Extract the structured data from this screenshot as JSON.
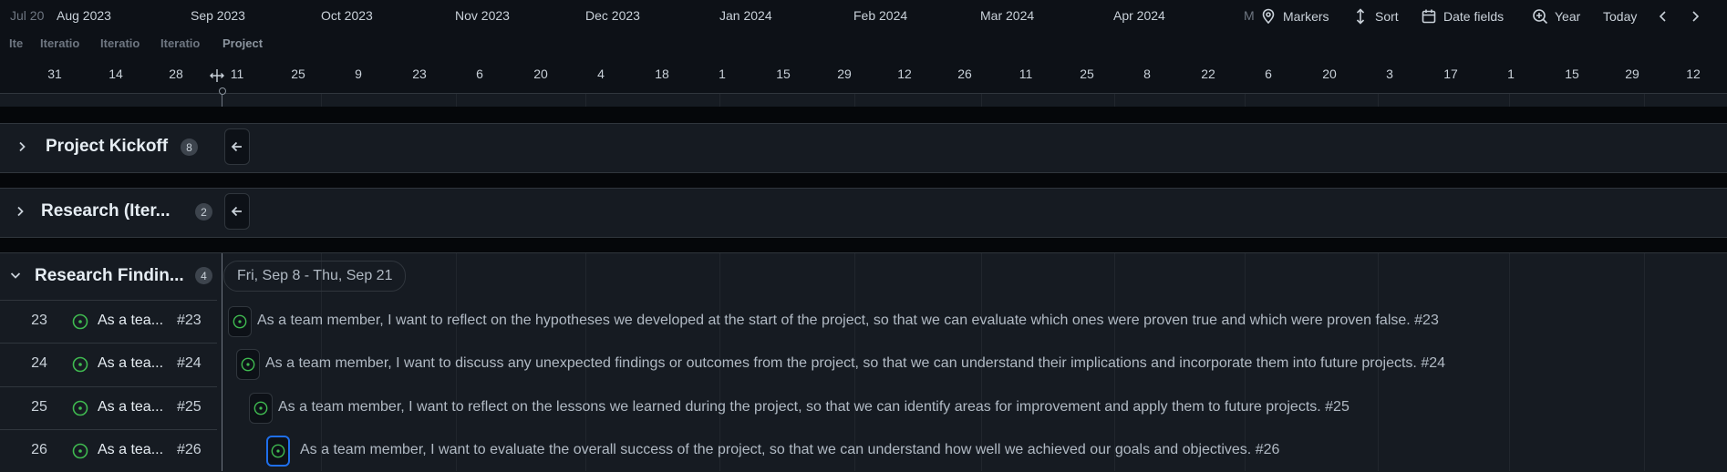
{
  "timeline": {
    "months": [
      "Jul 20",
      "Aug 2023",
      "Sep 2023",
      "Oct 2023",
      "Nov 2023",
      "Dec 2023",
      "Jan 2024",
      "Feb 2024",
      "Mar 2024",
      "Apr 2024",
      "M"
    ],
    "days": [
      "31",
      "14",
      "28",
      "11",
      "25",
      "9",
      "23",
      "6",
      "20",
      "4",
      "18",
      "1",
      "15",
      "29",
      "12",
      "26",
      "11",
      "25",
      "8",
      "22",
      "6",
      "20",
      "3",
      "17",
      "1",
      "15",
      "29",
      "12"
    ]
  },
  "toolbar": {
    "markers": "Markers",
    "sort": "Sort",
    "date_fields": "Date fields",
    "zoom": "Year",
    "today": "Today",
    "prev_icon": "chevron-left-icon",
    "next_icon": "chevron-right-icon"
  },
  "iteration_labels": [
    "Ite",
    "Iteratio",
    "Iteratio",
    "Iteratio",
    "Project"
  ],
  "groups": [
    {
      "title": "Project Kickoff",
      "count": "8",
      "expanded": false
    },
    {
      "title": "Research (Iter...",
      "count": "2",
      "expanded": false
    },
    {
      "title": "Research Findin...",
      "count": "4",
      "expanded": true,
      "date_range": "Fri, Sep 8 - Thu, Sep 21"
    }
  ],
  "rows": [
    {
      "num": "23",
      "title": "As a tea...",
      "id": "#23",
      "bar_text": "As a team member, I want to reflect on the hypotheses we developed at the start of the project, so that we can evaluate which ones were proven true and which were proven false. #23"
    },
    {
      "num": "24",
      "title": "As a tea...",
      "id": "#24",
      "bar_text": "As a team member, I want to discuss any unexpected findings or outcomes from the project, so that we can understand their implications and incorporate them into future projects. #24"
    },
    {
      "num": "25",
      "title": "As a tea...",
      "id": "#25",
      "bar_text": "As a team member, I want to reflect on the lessons we learned during the project, so that we can identify areas for improvement and apply them to future projects. #25"
    },
    {
      "num": "26",
      "title": "As a tea...",
      "id": "#26",
      "bar_text": "As a team member, I want to evaluate the overall success of the project, so that we can understand how well we achieved our goals and objectives. #26"
    }
  ],
  "colors": {
    "background": "#0d1117",
    "open_issue": "#3fb950",
    "selected": "#1f6feb"
  }
}
